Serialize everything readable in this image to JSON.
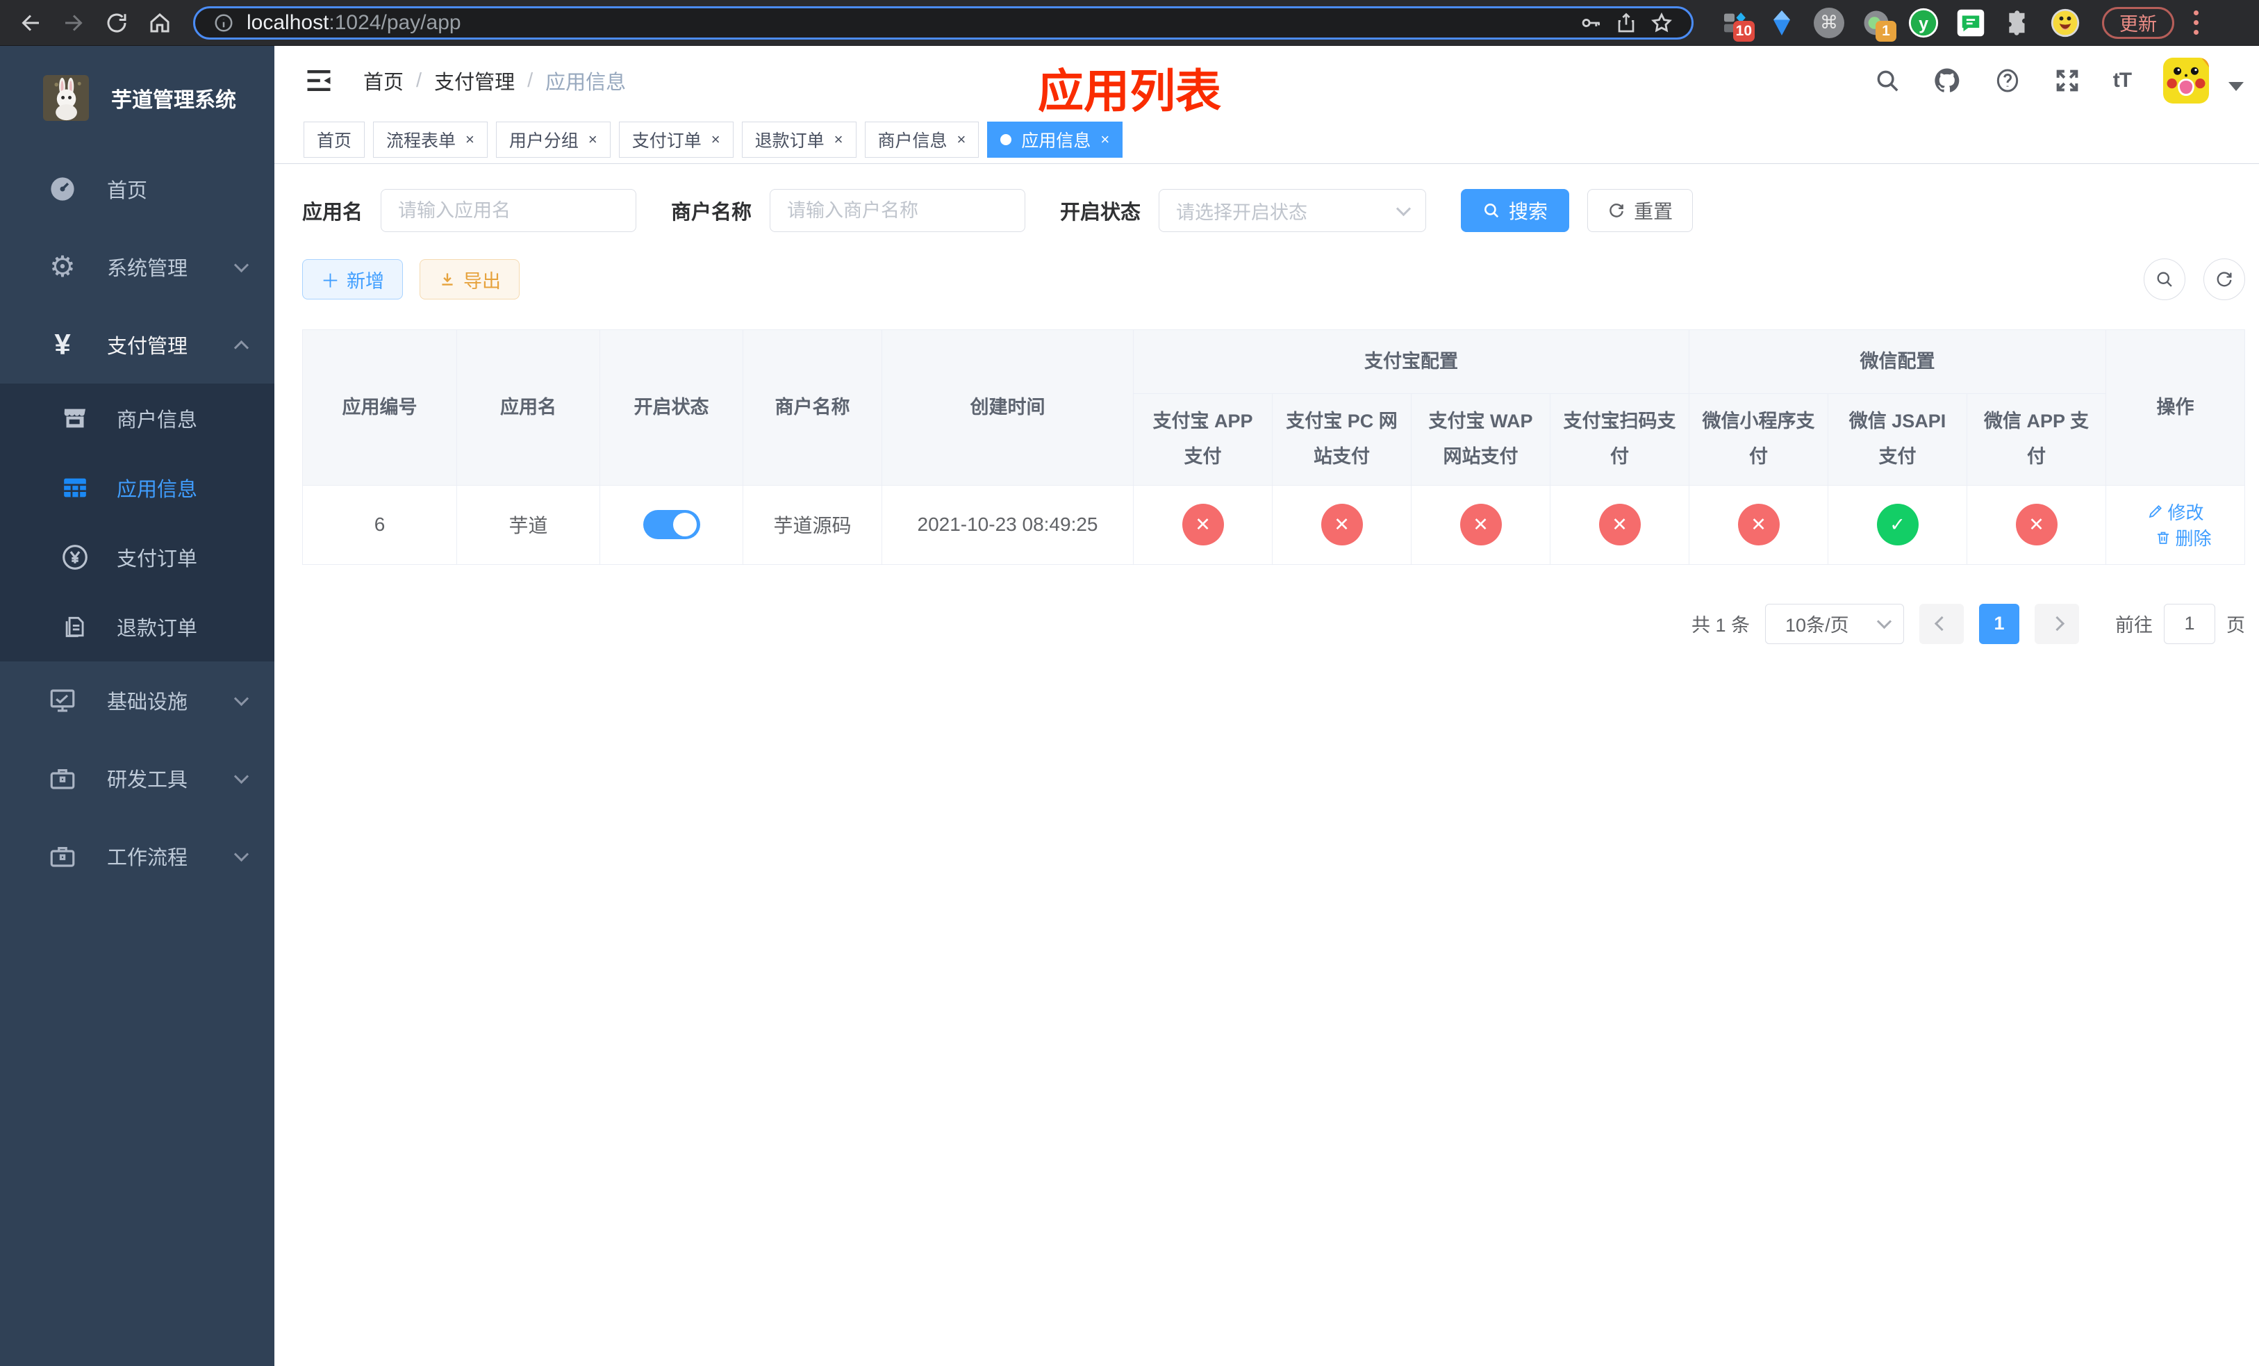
{
  "browser": {
    "url_host": "localhost",
    "url_path": ":1024/pay/app",
    "ext_badge_a": "10",
    "ext_badge_b": "1",
    "update_label": "更新"
  },
  "annotation": {
    "title": "应用列表"
  },
  "sidebar": {
    "app_title": "芋道管理系统",
    "items": [
      {
        "label": "首页"
      },
      {
        "label": "系统管理"
      },
      {
        "label": "支付管理"
      },
      {
        "label": "基础设施"
      },
      {
        "label": "研发工具"
      },
      {
        "label": "工作流程"
      }
    ],
    "submenu": [
      {
        "label": "商户信息"
      },
      {
        "label": "应用信息"
      },
      {
        "label": "支付订单"
      },
      {
        "label": "退款订单"
      }
    ]
  },
  "breadcrumb": {
    "items": [
      "首页",
      "支付管理",
      "应用信息"
    ],
    "separator": "/"
  },
  "tabs": [
    {
      "label": "首页"
    },
    {
      "label": "流程表单"
    },
    {
      "label": "用户分组"
    },
    {
      "label": "支付订单"
    },
    {
      "label": "退款订单"
    },
    {
      "label": "商户信息"
    },
    {
      "label": "应用信息"
    }
  ],
  "filters": {
    "app_name_label": "应用名",
    "app_name_placeholder": "请输入应用名",
    "merchant_label": "商户名称",
    "merchant_placeholder": "请输入商户名称",
    "status_label": "开启状态",
    "status_placeholder": "请选择开启状态",
    "search_label": "搜索",
    "reset_label": "重置"
  },
  "toolbar": {
    "add_label": "新增",
    "export_label": "导出"
  },
  "table": {
    "columns": [
      "应用编号",
      "应用名",
      "开启状态",
      "商户名称",
      "创建时间"
    ],
    "group_alipay": {
      "label": "支付宝配置",
      "children": [
        "支付宝 APP 支付",
        "支付宝 PC 网站支付",
        "支付宝 WAP 网站支付",
        "支付宝扫码支付"
      ]
    },
    "group_wechat": {
      "label": "微信配置",
      "children": [
        "微信小程序支付",
        "微信 JSAPI 支付",
        "微信 APP 支付"
      ]
    },
    "actions_label": "操作",
    "row": {
      "id": "6",
      "name": "芋道",
      "enabled": true,
      "merchant": "芋道源码",
      "created_at": "2021-10-23 08:49:25",
      "statuses": [
        "disabled",
        "disabled",
        "disabled",
        "disabled",
        "disabled",
        "enabled",
        "disabled"
      ],
      "edit_label": "修改",
      "delete_label": "删除"
    }
  },
  "pagination": {
    "total": "共 1 条",
    "page_size": "10条/页",
    "current_page": "1",
    "goto_label": "前往",
    "goto_value": "1",
    "goto_unit": "页"
  },
  "icons": {
    "close": "×",
    "check": "✓",
    "cross": "✕",
    "plus": "＋",
    "gear": "⚙",
    "yen": "¥",
    "question": "?",
    "font_size": "tT"
  },
  "colors": {
    "accent": "#409eff",
    "danger": "#f56c6c",
    "success": "#13ce66",
    "annotation": "#fa2c00",
    "sidebar": "#304156"
  }
}
